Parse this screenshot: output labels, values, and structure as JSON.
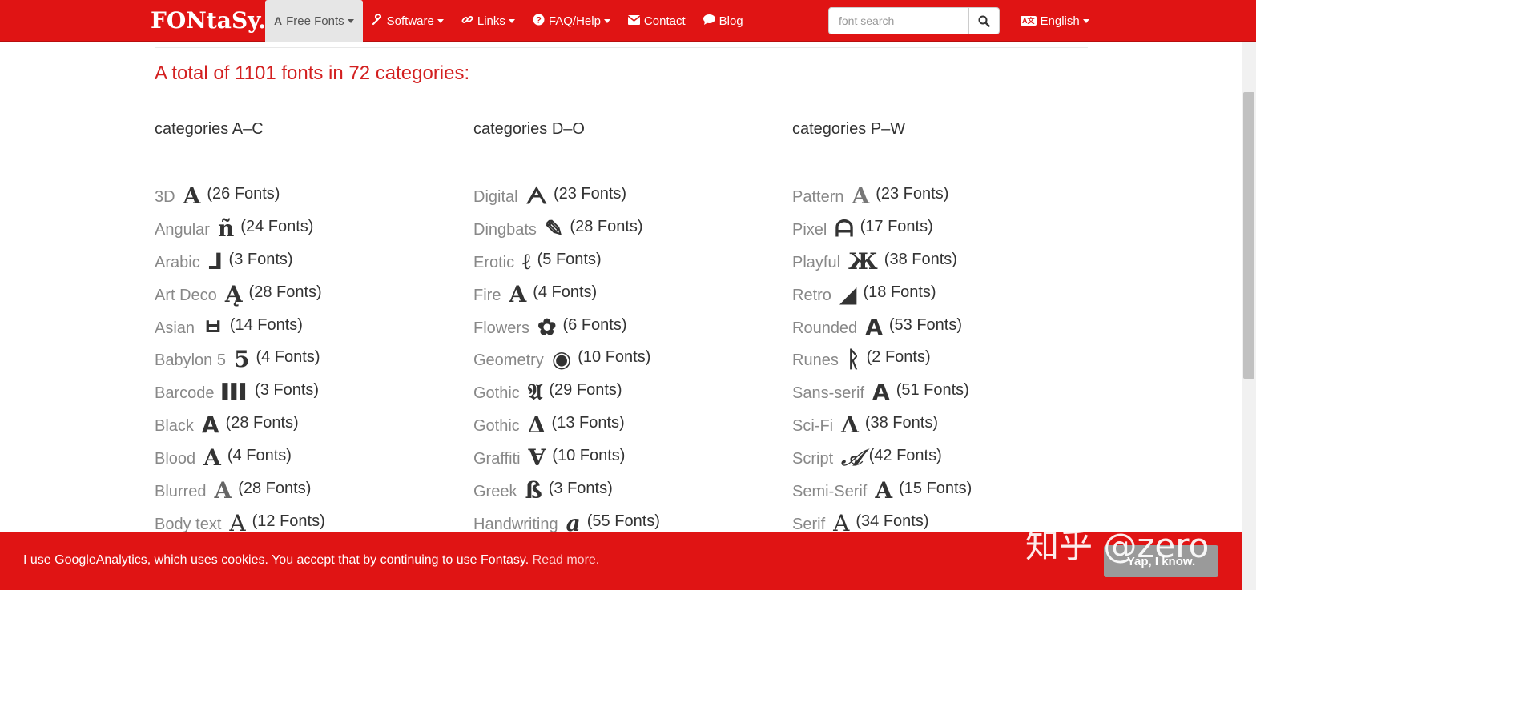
{
  "logo": "FONtaSy.dE",
  "nav": {
    "items": [
      {
        "label": "Free Fonts",
        "icon": "A",
        "active": true
      },
      {
        "label": "Software",
        "icon": "wrench-icon"
      },
      {
        "label": "Links",
        "icon": "link-icon"
      },
      {
        "label": "FAQ/Help",
        "icon": "question-icon"
      },
      {
        "label": "Contact",
        "icon": "envelope-icon"
      },
      {
        "label": "Blog",
        "icon": "comment-icon"
      }
    ],
    "search_placeholder": "font search",
    "language": "English"
  },
  "heading": "A total of 1101 fonts in 72 categories:",
  "columns": [
    {
      "title": "categories A–C",
      "items": [
        {
          "name": "3D",
          "glyph": "A",
          "count": "(26 Fonts)"
        },
        {
          "name": "Angular",
          "glyph": "ñ",
          "count": "(24 Fonts)"
        },
        {
          "name": "Arabic",
          "glyph": "⅃",
          "count": "(3 Fonts)"
        },
        {
          "name": "Art Deco",
          "glyph": "Ą",
          "count": "(28 Fonts)"
        },
        {
          "name": "Asian",
          "glyph": "ㅂ",
          "count": "(14 Fonts)"
        },
        {
          "name": "Babylon 5",
          "glyph": "5",
          "count": "(4 Fonts)"
        },
        {
          "name": "Barcode",
          "glyph": "▌▌▌",
          "count": "(3 Fonts)"
        },
        {
          "name": "Black",
          "glyph": "A",
          "count": "(28 Fonts)"
        },
        {
          "name": "Blood",
          "glyph": "A",
          "count": "(4 Fonts)"
        },
        {
          "name": "Blurred",
          "glyph": "A",
          "count": "(28 Fonts)"
        },
        {
          "name": "Body text",
          "glyph": "A",
          "count": "(12 Fonts)"
        }
      ]
    },
    {
      "title": "categories D–O",
      "items": [
        {
          "name": "Digital",
          "glyph": "ᗅ",
          "count": "(23 Fonts)"
        },
        {
          "name": "Dingbats",
          "glyph": "✎",
          "count": "(28 Fonts)"
        },
        {
          "name": "Erotic",
          "glyph": "ℓ",
          "count": "(5 Fonts)"
        },
        {
          "name": "Fire",
          "glyph": "A",
          "count": "(4 Fonts)"
        },
        {
          "name": "Flowers",
          "glyph": "✿",
          "count": "(6 Fonts)"
        },
        {
          "name": "Geometry",
          "glyph": "◉",
          "count": "(10 Fonts)"
        },
        {
          "name": "Gothic",
          "glyph": "𝔄",
          "count": "(29 Fonts)"
        },
        {
          "name": "Gothic",
          "glyph": "Δ",
          "count": "(13 Fonts)"
        },
        {
          "name": "Graffiti",
          "glyph": "Ɐ",
          "count": "(10 Fonts)"
        },
        {
          "name": "Greek",
          "glyph": "ß",
          "count": "(3 Fonts)"
        },
        {
          "name": "Handwriting",
          "glyph": "a",
          "count": "(55 Fonts)"
        }
      ]
    },
    {
      "title": "categories P–W",
      "items": [
        {
          "name": "Pattern",
          "glyph": "A",
          "count": "(23 Fonts)"
        },
        {
          "name": "Pixel",
          "glyph": "ᗩ",
          "count": "(17 Fonts)"
        },
        {
          "name": "Playful",
          "glyph": "Ж",
          "count": "(38 Fonts)"
        },
        {
          "name": "Retro",
          "glyph": "◢",
          "count": "(18 Fonts)"
        },
        {
          "name": "Rounded",
          "glyph": "A",
          "count": "(53 Fonts)"
        },
        {
          "name": "Runes",
          "glyph": "ᚱ",
          "count": "(2 Fonts)"
        },
        {
          "name": "Sans-serif",
          "glyph": "A",
          "count": "(51 Fonts)"
        },
        {
          "name": "Sci-Fi",
          "glyph": "Ʌ",
          "count": "(38 Fonts)"
        },
        {
          "name": "Script",
          "glyph": "𝒜",
          "count": "(42 Fonts)"
        },
        {
          "name": "Semi-Serif",
          "glyph": "A",
          "count": "(15 Fonts)"
        },
        {
          "name": "Serif",
          "glyph": "A",
          "count": "(34 Fonts)"
        }
      ]
    }
  ],
  "cookie": {
    "message": "I use GoogleAnalytics, which uses cookies. You accept that by continuing to use Fontasy.",
    "link": "Read more.",
    "button": "Yap, I know."
  },
  "watermark": "知乎 @zero",
  "colors": {
    "brand": "#e01414",
    "heading": "#d32020"
  }
}
